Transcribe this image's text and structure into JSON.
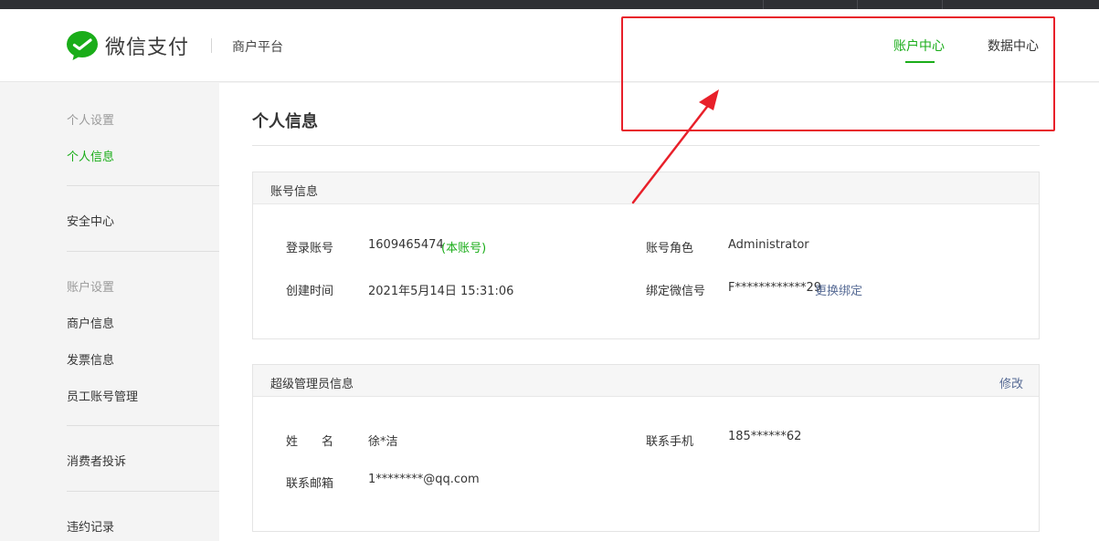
{
  "header": {
    "brand": "微信支付",
    "subbrand": "商户平台",
    "nav": [
      {
        "label": "账户中心",
        "active": true
      },
      {
        "label": "数据中心",
        "active": false
      }
    ]
  },
  "sidebar": {
    "items": [
      {
        "label": "个人设置",
        "type": "group"
      },
      {
        "label": "个人信息",
        "type": "active"
      },
      {
        "label": "安全中心",
        "type": "item"
      },
      {
        "label": "账户设置",
        "type": "group"
      },
      {
        "label": "商户信息",
        "type": "item"
      },
      {
        "label": "发票信息",
        "type": "item"
      },
      {
        "label": "员工账号管理",
        "type": "item"
      },
      {
        "label": "消费者投诉",
        "type": "item"
      },
      {
        "label": "违约记录",
        "type": "item"
      }
    ]
  },
  "main": {
    "title": "个人信息",
    "account_card": {
      "title": "账号信息",
      "login_label": "登录账号",
      "login_value": "1609465474",
      "login_tag": "(本账号)",
      "role_label": "账号角色",
      "role_value": "Administrator",
      "created_label": "创建时间",
      "created_value": "2021年5月14日 15:31:06",
      "wechat_label": "绑定微信号",
      "wechat_value": "F************29",
      "wechat_action": "更换绑定"
    },
    "admin_card": {
      "title": "超级管理员信息",
      "edit_label": "修改",
      "name_label": "姓　　名",
      "name_value": "徐*洁",
      "phone_label": "联系手机",
      "phone_value": "185******62",
      "email_label": "联系邮箱",
      "email_value": "1********@qq.com"
    }
  },
  "colors": {
    "accent": "#1aad19",
    "link": "#576b95",
    "annotation": "#e8202a"
  }
}
